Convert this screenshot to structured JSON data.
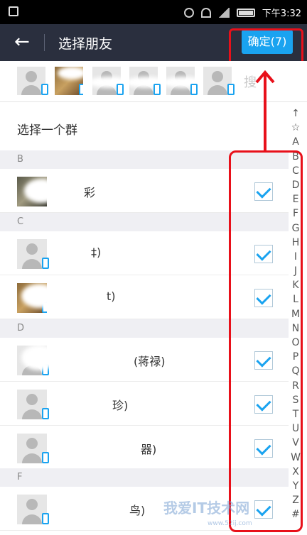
{
  "status": {
    "time": "下午3:32"
  },
  "header": {
    "back_glyph": "←",
    "title": "选择朋友",
    "confirm_label": "确定(7)"
  },
  "search": {
    "hint": "搜"
  },
  "group": {
    "label": "选择一个群"
  },
  "sections": [
    {
      "letter": "B",
      "contacts": [
        {
          "name": "彩"
        }
      ]
    },
    {
      "letter": "C",
      "contacts": [
        {
          "name": "‡)"
        },
        {
          "name": "t)"
        }
      ]
    },
    {
      "letter": "D",
      "contacts": [
        {
          "name": "(蒋禄)"
        },
        {
          "name": "珍)"
        },
        {
          "name": "器)"
        }
      ]
    },
    {
      "letter": "F",
      "contacts": [
        {
          "name": "鸟)"
        }
      ]
    }
  ],
  "index_letters": [
    "↑",
    "☆",
    "A",
    "B",
    "C",
    "D",
    "E",
    "F",
    "G",
    "H",
    "I",
    "J",
    "K",
    "L",
    "M",
    "N",
    "O",
    "P",
    "Q",
    "R",
    "S",
    "T",
    "U",
    "V",
    "W",
    "X",
    "Y",
    "Z",
    "#"
  ],
  "watermark": {
    "text": "我爱IT技术网",
    "url": "www.52ij.com"
  },
  "colors": {
    "titlebar": "#2a2f3e",
    "accent": "#1aa3f0",
    "highlight": "#e8101a"
  }
}
